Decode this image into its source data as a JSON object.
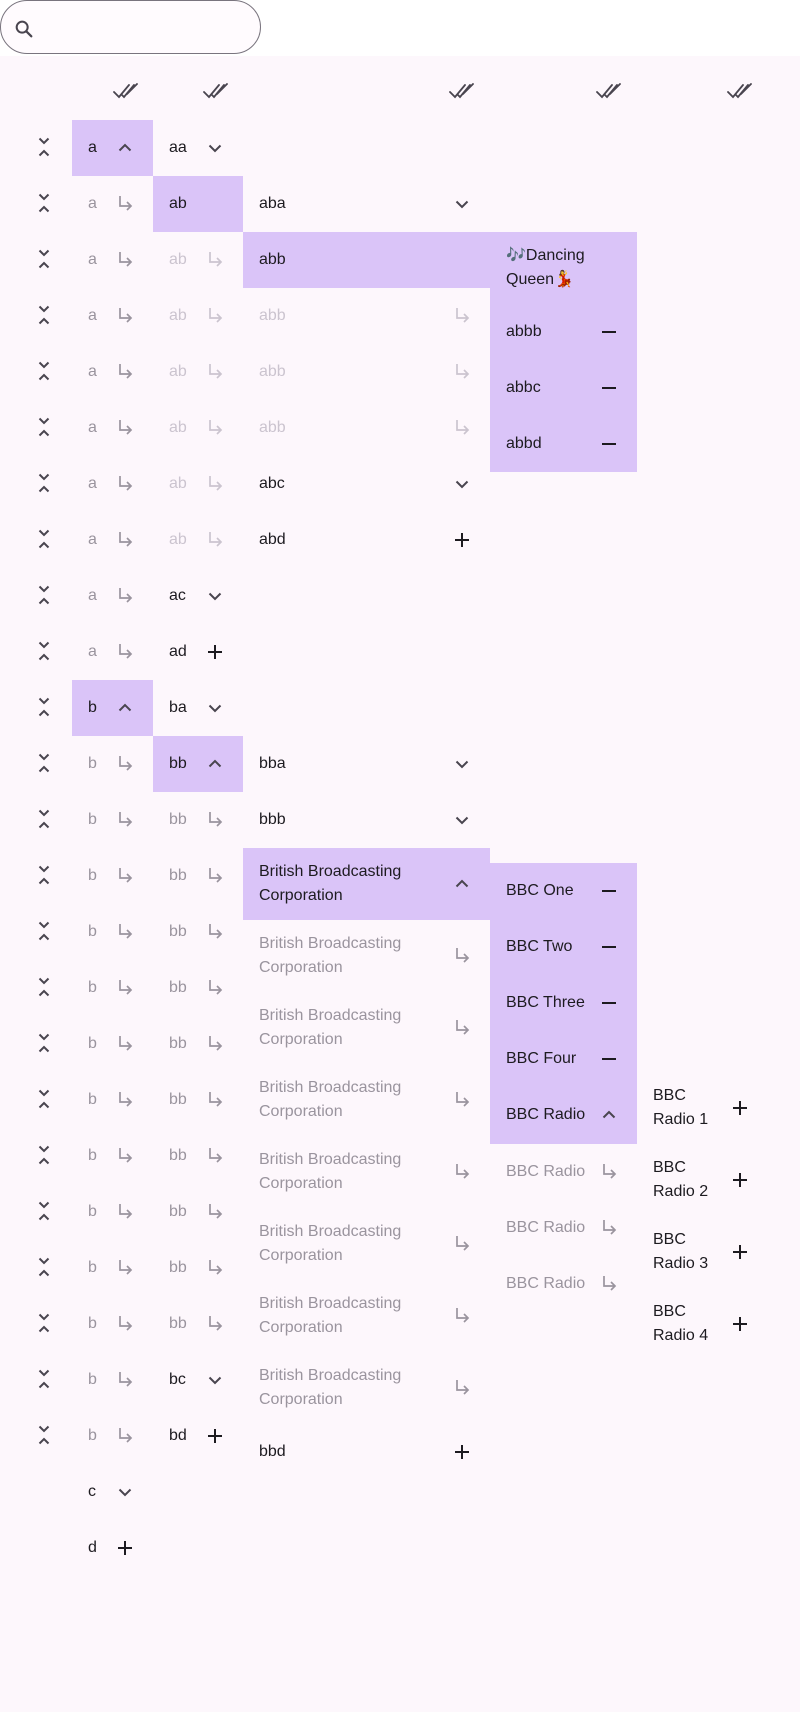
{
  "search": {
    "placeholder": "",
    "value": ""
  },
  "header": {
    "icon": "done-all-icon",
    "columns": 5
  },
  "colors": {
    "highlight": "#dac4f8",
    "background": "#fdf7fc",
    "dim_text": "#9a949e",
    "very_dim_text": "#cbc4cf"
  },
  "rows": {
    "a": "a",
    "aa": "aa",
    "ab": "ab",
    "aba": "aba",
    "abb": "abb",
    "dancing_queen": "🎶Dancing Queen💃",
    "abbb": "abbb",
    "abbc": "abbc",
    "abbd": "abbd",
    "abc": "abc",
    "abd": "abd",
    "ac": "ac",
    "ad": "ad",
    "b": "b",
    "ba": "ba",
    "bb": "bb",
    "bba": "bba",
    "bbb": "bbb",
    "bbc": "British Broadcasting Corporation",
    "bbc_one": "BBC One",
    "bbc_two": "BBC Two",
    "bbc_three": "BBC Three",
    "bbc_four": "BBC Four",
    "bbc_radio": "BBC Radio",
    "bbc_radio_1": "BBC Radio 1",
    "bbc_radio_2": "BBC Radio 2",
    "bbc_radio_3": "BBC Radio 3",
    "bbc_radio_4": "BBC Radio 4",
    "bc": "bc",
    "bd": "bd",
    "bbd": "bbd",
    "c": "c",
    "d": "d"
  }
}
